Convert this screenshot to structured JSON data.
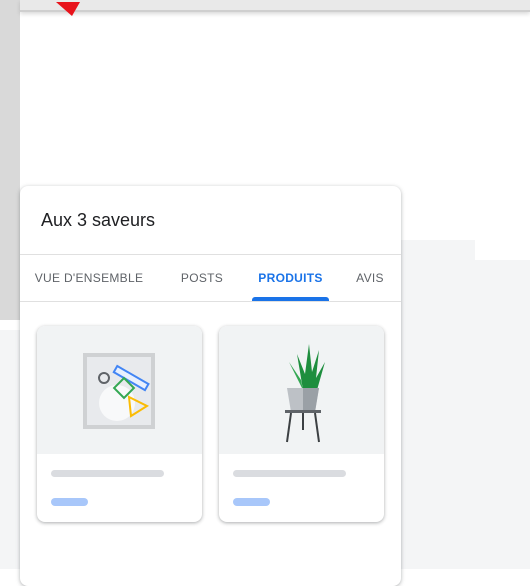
{
  "business": {
    "name": "Aux 3 saveurs"
  },
  "tabs": [
    {
      "label": "VUE D'ENSEMBLE",
      "active": false
    },
    {
      "label": "POSTS",
      "active": false
    },
    {
      "label": "PRODUITS",
      "active": true
    },
    {
      "label": "AVIS",
      "active": false
    }
  ],
  "products": [
    {
      "icon": "shapes-illustration-icon"
    },
    {
      "icon": "potted-plant-icon"
    }
  ],
  "colors": {
    "accent": "#1a73e8",
    "placeholder_gray": "#dadce0",
    "placeholder_blue": "#a8c7fa",
    "cursor": "#e8131b"
  }
}
